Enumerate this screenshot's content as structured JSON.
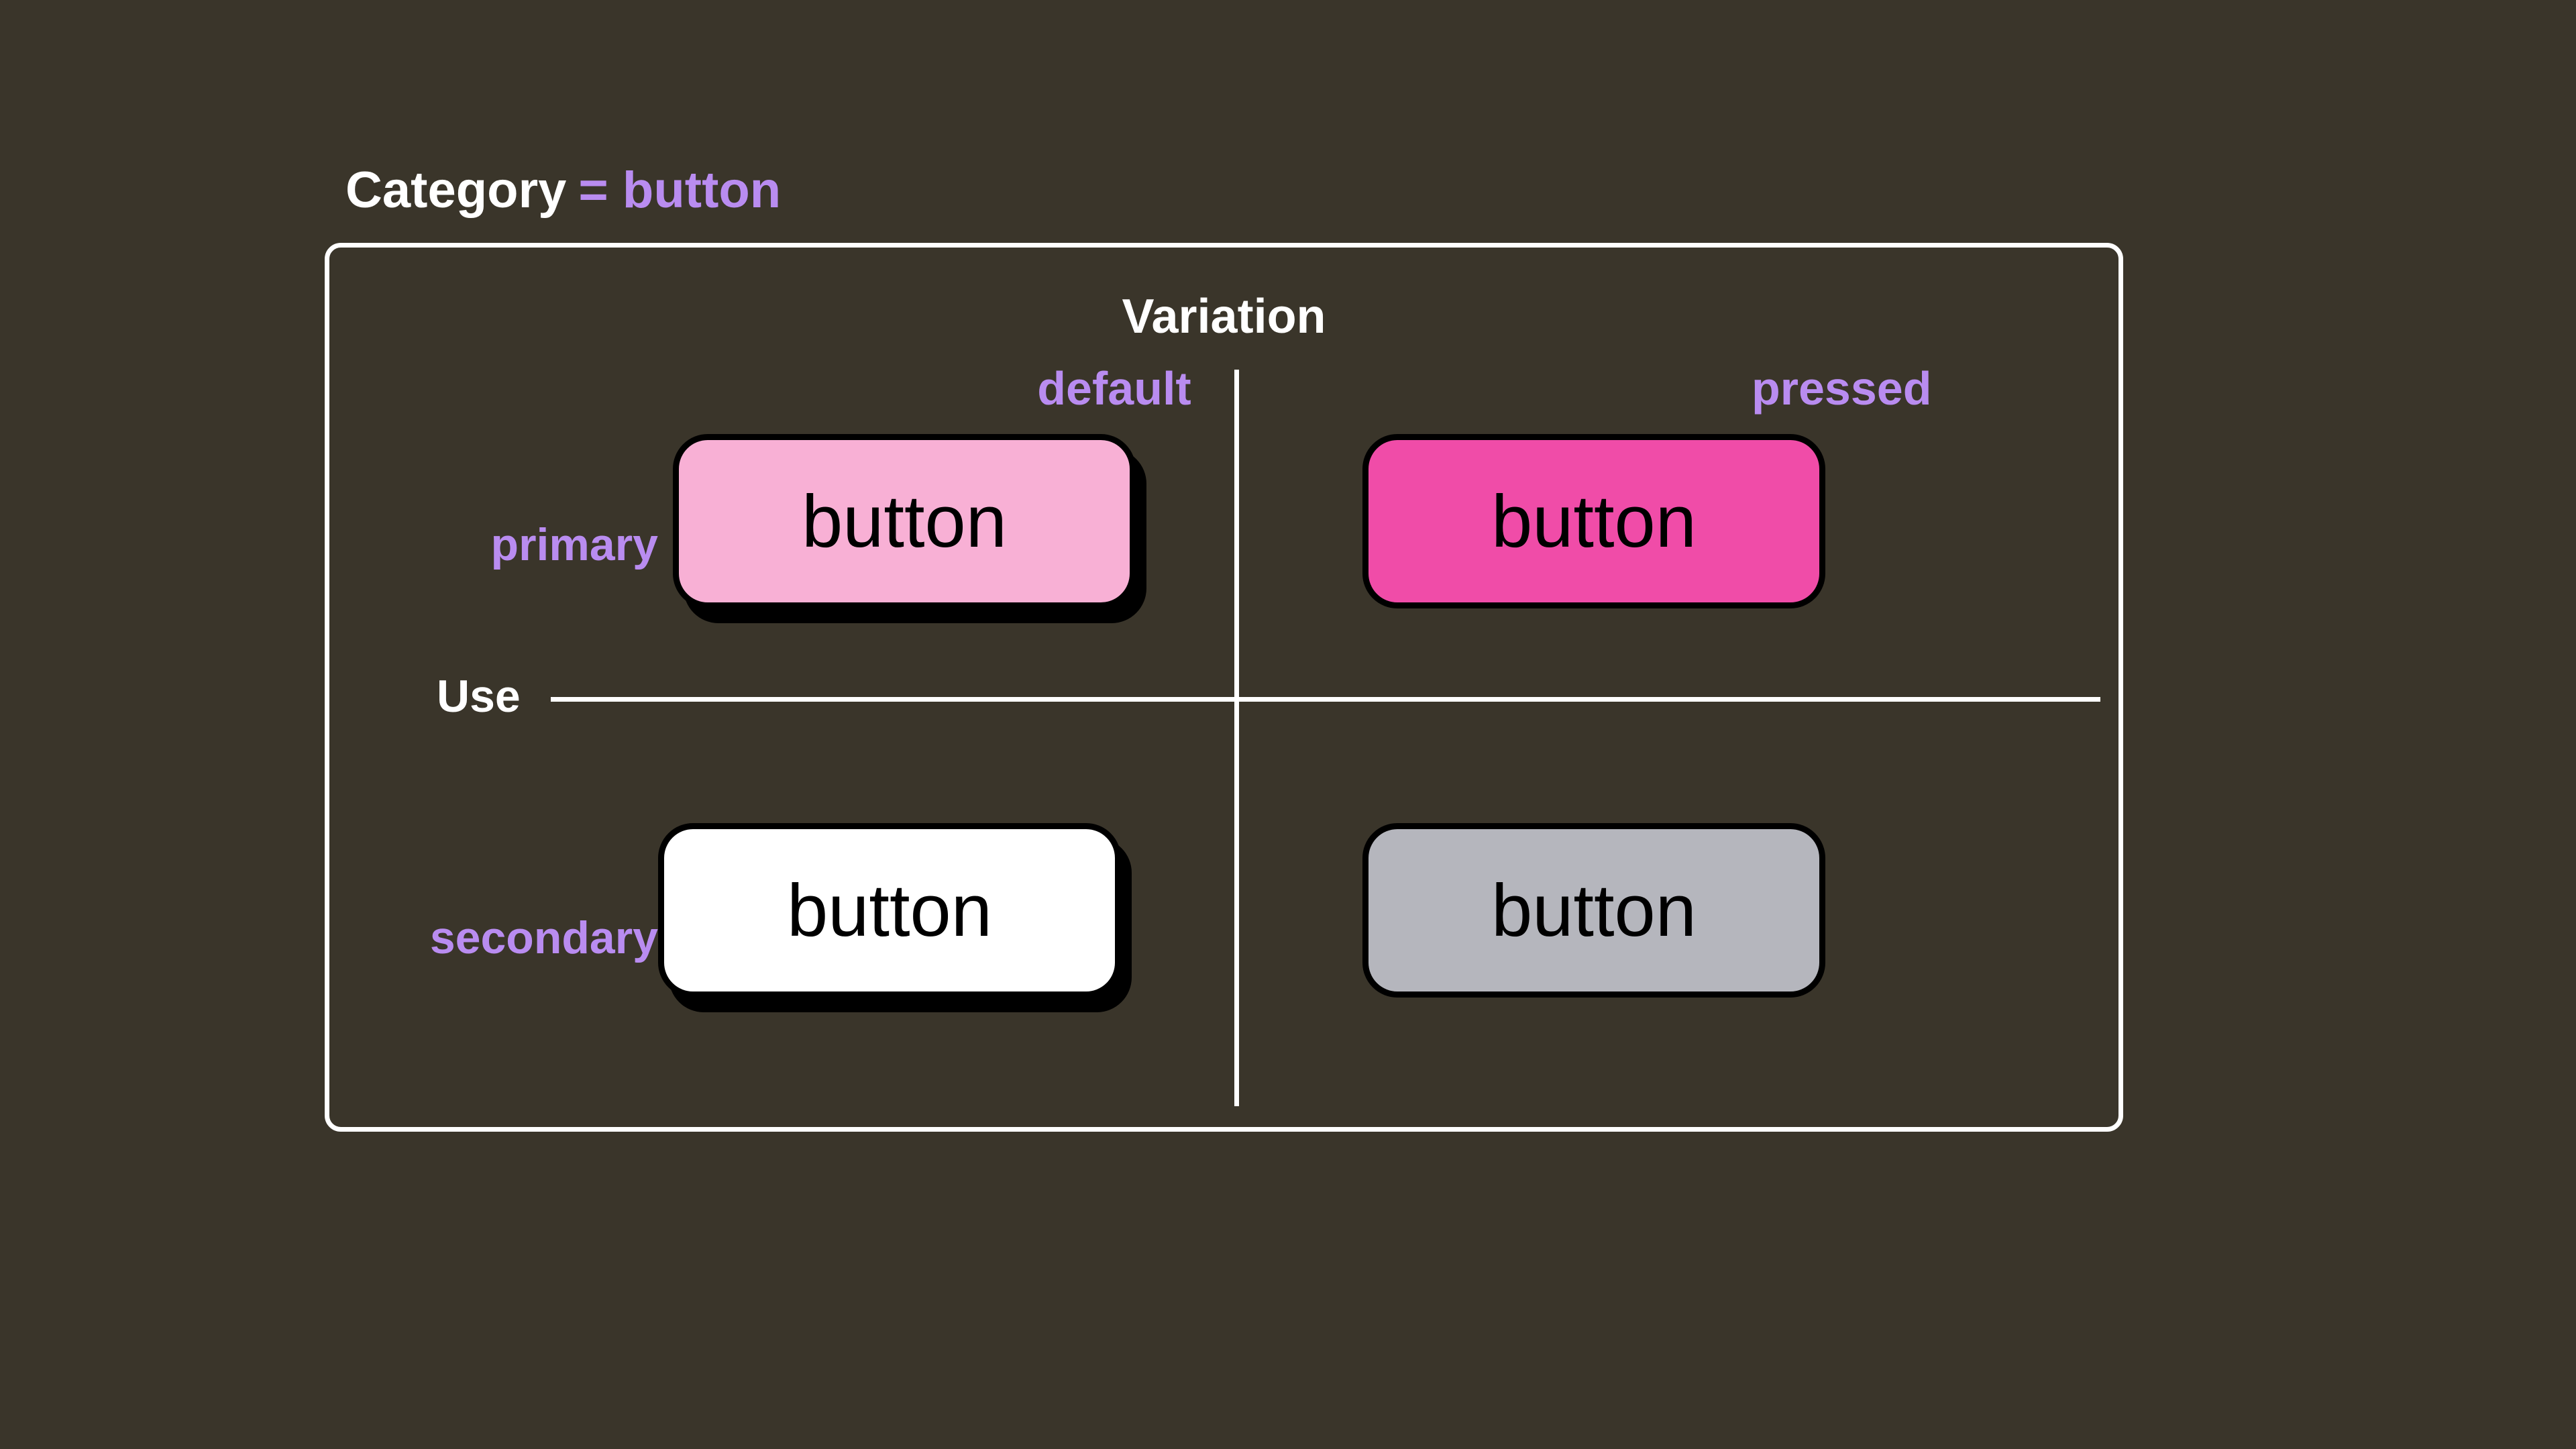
{
  "header": {
    "category_label": "Category",
    "category_equals": "= button"
  },
  "axes": {
    "variation_title": "Variation",
    "use_title": "Use",
    "col_default": "default",
    "col_pressed": "pressed",
    "row_primary": "primary",
    "row_secondary": "secondary"
  },
  "buttons": {
    "primary_default": "button",
    "primary_pressed": "button",
    "secondary_default": "button",
    "secondary_pressed": "button"
  },
  "colors": {
    "background": "#3a352a",
    "accent_purple": "#b98cf0",
    "primary_default_bg": "#f8b0d5",
    "primary_pressed_bg": "#f04ca8",
    "secondary_default_bg": "#ffffff",
    "secondary_pressed_bg": "#b5b6bd"
  }
}
